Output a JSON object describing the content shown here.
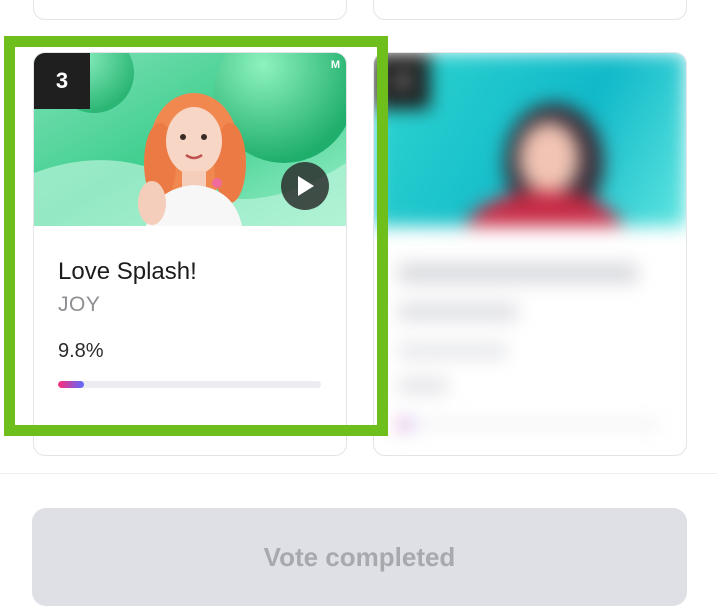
{
  "cards": [
    {
      "rank": "3",
      "title": "Love Splash!",
      "artist": "JOY",
      "percent_text": "9.8%",
      "progress": 0.098,
      "thumb_logo": "M"
    },
    {
      "rank": "4",
      "title": "",
      "artist": "",
      "percent_text": "",
      "progress": 0.05,
      "blurred": true
    }
  ],
  "vote_button": {
    "label": "Vote completed",
    "state": "disabled"
  },
  "colors": {
    "highlight": "#6fbf1c",
    "progress_start": "#ff2d78",
    "progress_end": "#5a6cff",
    "button_bg": "#dfe0e5",
    "button_text": "#a8a9ae"
  },
  "icons": [
    "play-icon"
  ]
}
